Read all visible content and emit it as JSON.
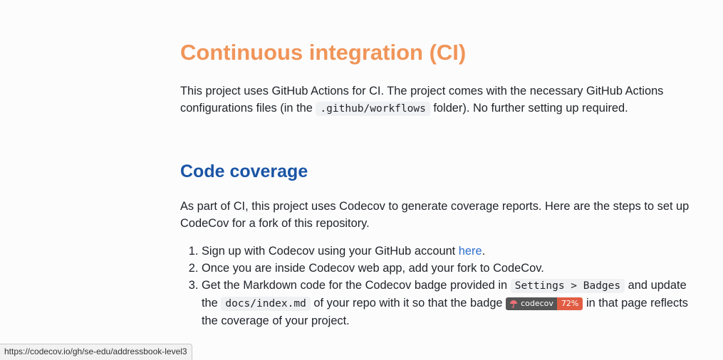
{
  "ci": {
    "title": "Continuous integration (CI)",
    "para_before_code": "This project uses GitHub Actions for CI. The project comes with the necessary GitHub Actions configurations files (in the ",
    "code": ".github/workflows",
    "para_after_code": " folder). No further setting up required."
  },
  "coverage": {
    "title": "Code coverage",
    "intro": "As part of CI, this project uses Codecov to generate coverage reports. Here are the steps to set up CodeCov for a fork of this repository.",
    "steps": {
      "s1_before": "Sign up with Codecov using your GitHub account ",
      "s1_link": "here",
      "s1_after": ".",
      "s2": "Once you are inside Codecov web app, add your fork to CodeCov.",
      "s3_part1": "Get the Markdown code for the Codecov badge provided in ",
      "s3_code1": "Settings > Badges",
      "s3_part2": " and update the ",
      "s3_code2": "docs/index.md",
      "s3_part3": " of your repo with it so that the badge ",
      "s3_part4": " in that page reflects the coverage of your project."
    },
    "badge": {
      "label": "codecov",
      "value": "72%",
      "label_color": "#555555",
      "value_color": "#e05d44"
    }
  },
  "status_bar": {
    "url": "https://codecov.io/gh/se-edu/addressbook-level3"
  },
  "colors": {
    "ci_heading": "#f0955a",
    "coverage_heading": "#1a55a5",
    "link": "#2f6fce"
  }
}
